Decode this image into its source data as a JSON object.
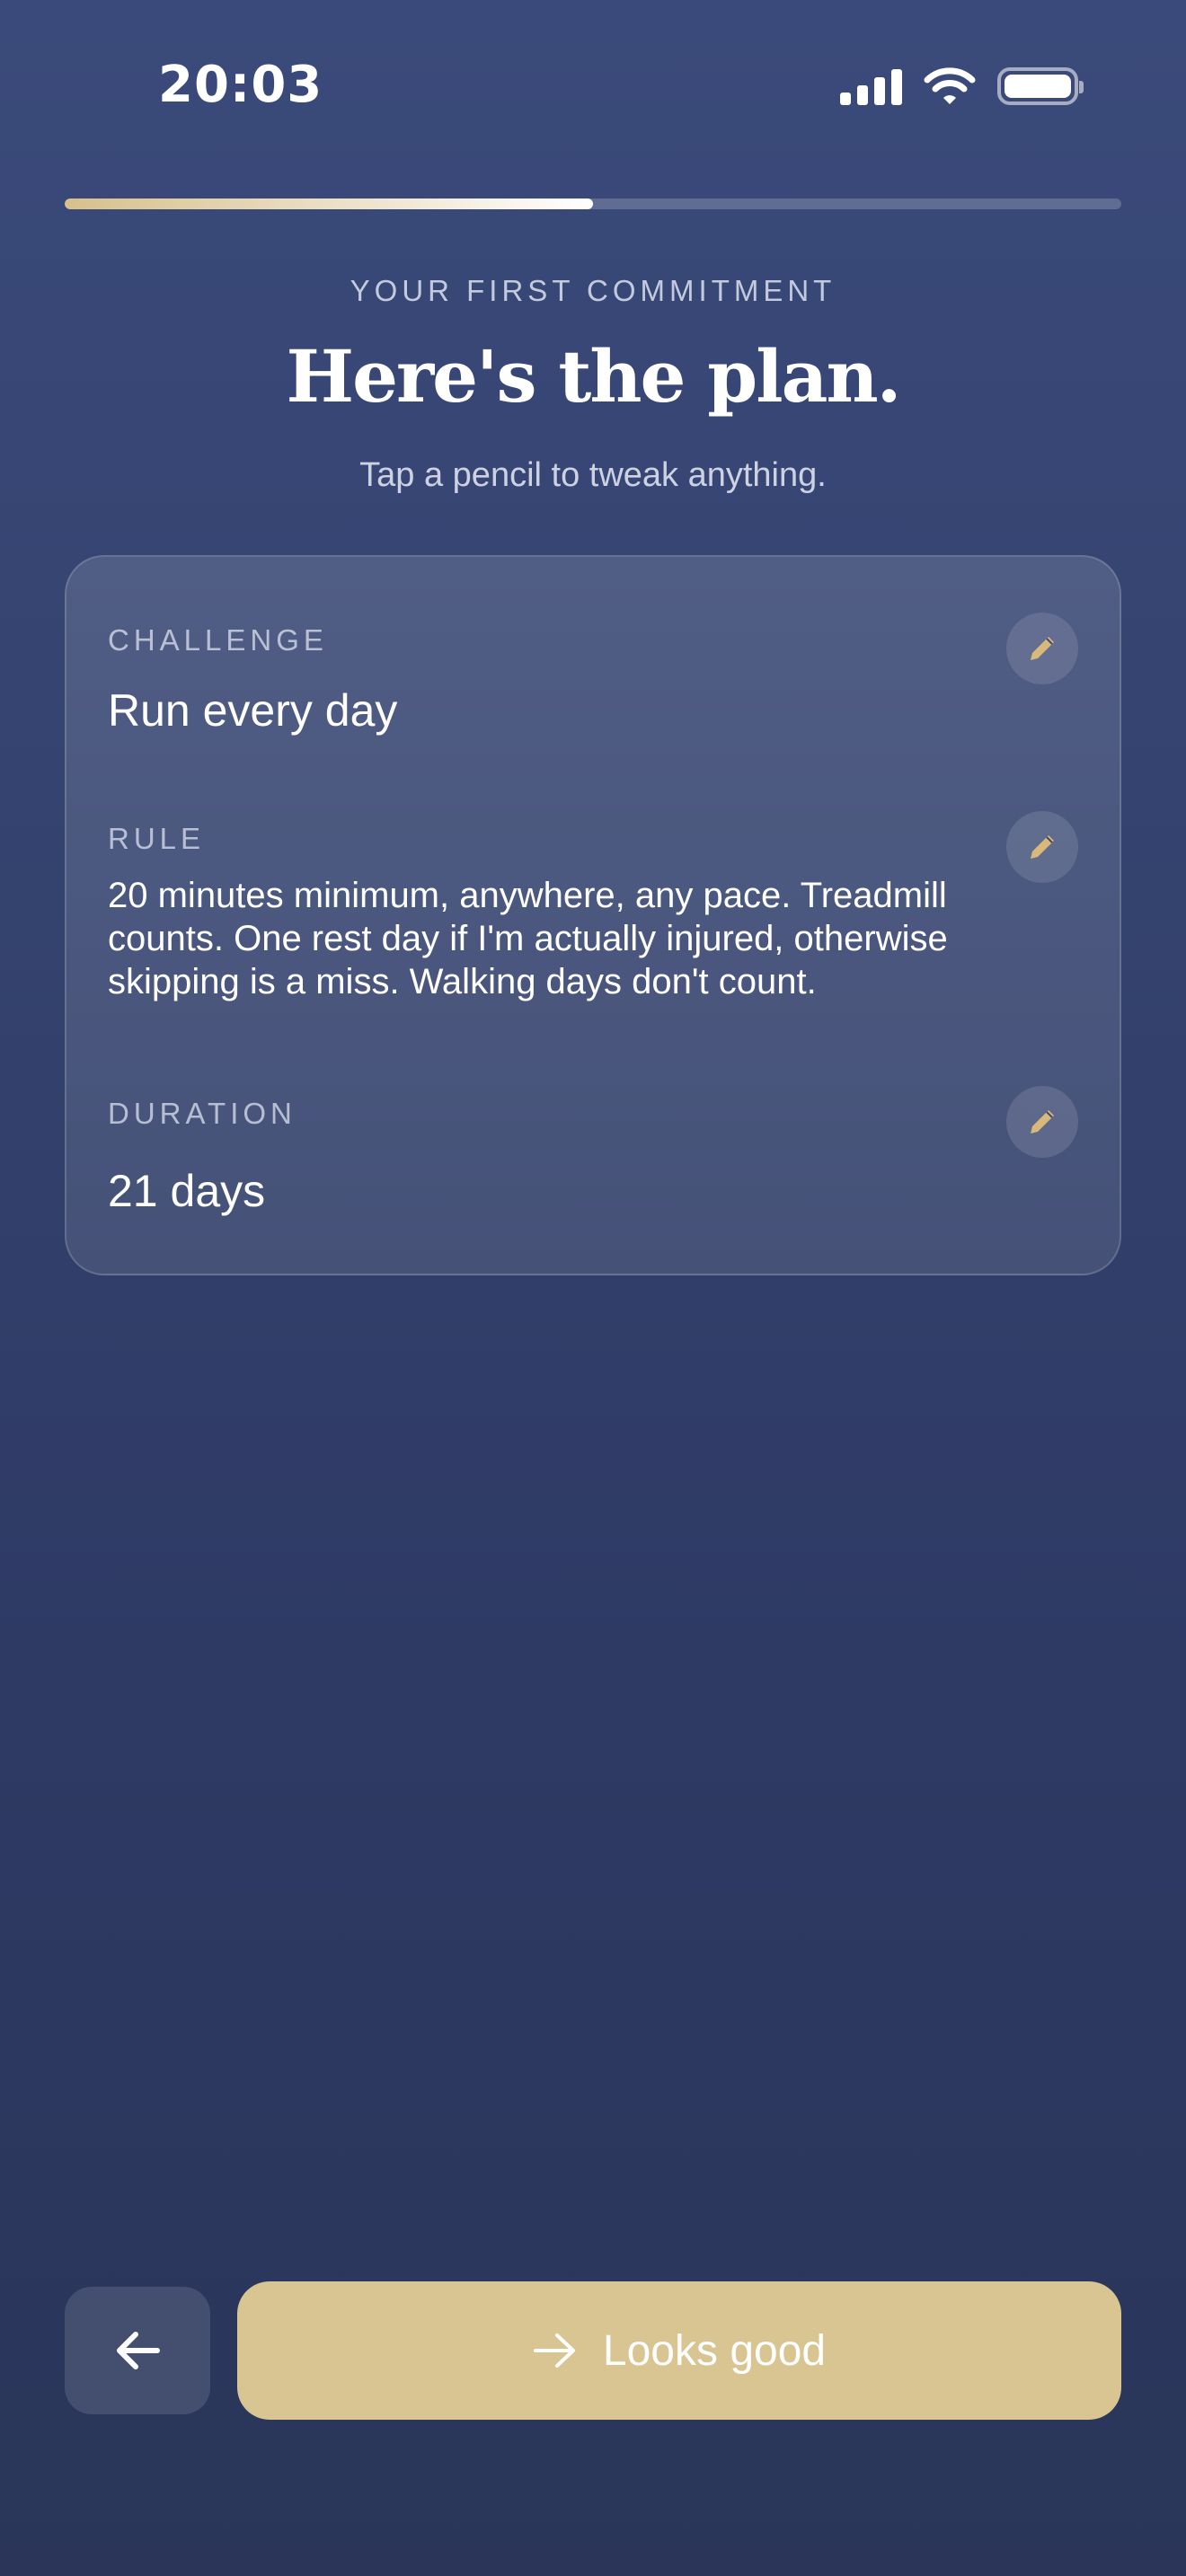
{
  "status_bar": {
    "time": "20:03",
    "icons": [
      "cellular-signal-icon",
      "wifi-icon",
      "battery-icon"
    ]
  },
  "progress": {
    "fraction": 0.5
  },
  "header": {
    "eyebrow": "YOUR FIRST COMMITMENT",
    "title": "Here's the plan.",
    "subtitle": "Tap a pencil to tweak anything."
  },
  "plan": {
    "fields": [
      {
        "label": "CHALLENGE",
        "value": "Run every day",
        "edit_icon": "pencil-icon"
      },
      {
        "label": "RULE",
        "value": "20 minutes minimum, anywhere, any pace. Treadmill counts. One rest day if I'm actually injured, otherwise skipping is a miss. Walking days don't count.",
        "edit_icon": "pencil-icon"
      },
      {
        "label": "DURATION",
        "value": "21 days",
        "edit_icon": "pencil-icon"
      }
    ]
  },
  "footer": {
    "back_icon": "arrow-left-icon",
    "primary_label": "Looks good",
    "primary_icon": "arrow-right-icon"
  },
  "colors": {
    "background_top": "#3a4a7a",
    "background_bottom": "#2a3559",
    "accent_gold": "#d9c591",
    "pencil_gold": "#d8b97a"
  }
}
